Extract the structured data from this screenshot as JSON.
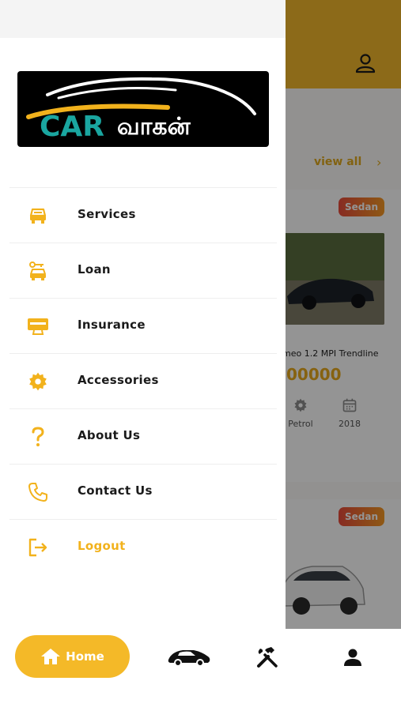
{
  "background": {
    "view_all_label": "view all",
    "cards": [
      {
        "badge": "Sedan",
        "name": "meo 1.2 MPI Trendline",
        "price": "00000",
        "specs": [
          {
            "icon": "gear-icon",
            "label": "Petrol"
          },
          {
            "icon": "calendar-icon",
            "label": "2018"
          }
        ]
      },
      {
        "badge": "Sedan"
      }
    ]
  },
  "drawer": {
    "logo": {
      "text_latin": "CAR",
      "text_tamil": "வாகன்"
    },
    "menu": [
      {
        "label": "Services",
        "icon": "car-front-icon"
      },
      {
        "label": "Loan",
        "icon": "car-key-icon"
      },
      {
        "label": "Insurance",
        "icon": "monitor-card-icon"
      },
      {
        "label": "Accessories",
        "icon": "gear-icon"
      },
      {
        "label": "About Us",
        "icon": "question-mark-icon"
      },
      {
        "label": "Contact Us",
        "icon": "phone-icon"
      },
      {
        "label": "Logout",
        "icon": "logout-icon"
      }
    ]
  },
  "bottom_nav": {
    "home_label": "Home",
    "items": [
      "home-icon",
      "car-side-icon",
      "tools-icon",
      "user-icon"
    ]
  },
  "colors": {
    "accent": "#f4b928",
    "brand_teal": "#1aa6a0",
    "badge_start": "#e84b3c",
    "badge_end": "#f59a24"
  }
}
